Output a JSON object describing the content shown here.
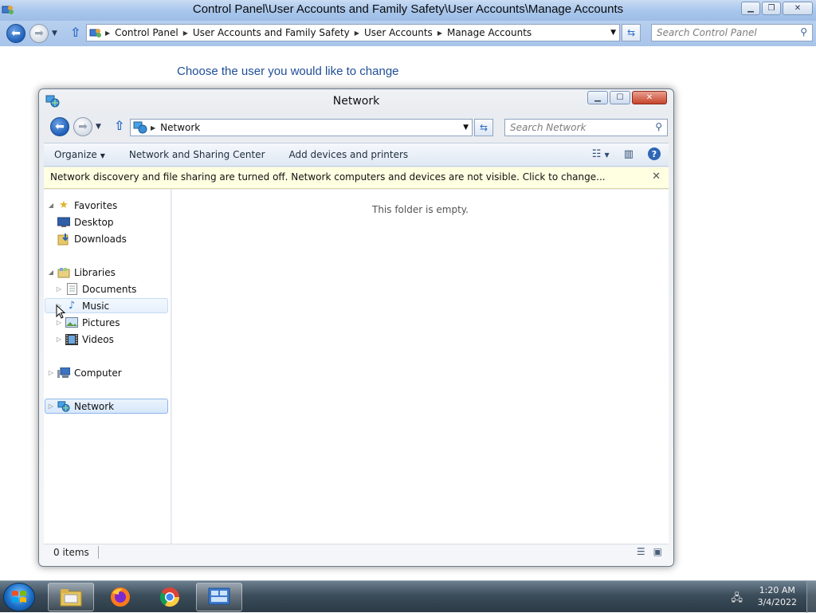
{
  "background_window": {
    "title": "Control Panel\\User Accounts and Family Safety\\User Accounts\\Manage Accounts",
    "breadcrumbs": [
      "Control Panel",
      "User Accounts and Family Safety",
      "User Accounts",
      "Manage Accounts"
    ],
    "search_placeholder": "Search Control Panel",
    "heading": "Choose the user you would like to change"
  },
  "network_window": {
    "title": "Network",
    "address": "Network",
    "search_placeholder": "Search Network",
    "toolbar": {
      "organize": "Organize",
      "network_center": "Network and Sharing Center",
      "add_devices": "Add devices and printers"
    },
    "infobar": "Network discovery and file sharing are turned off. Network computers and devices are not visible. Click to change...",
    "nav_tree": {
      "favorites": "Favorites",
      "desktop": "Desktop",
      "downloads": "Downloads",
      "libraries": "Libraries",
      "documents": "Documents",
      "music": "Music",
      "pictures": "Pictures",
      "videos": "Videos",
      "computer": "Computer",
      "network": "Network"
    },
    "empty_message": "This folder is empty.",
    "status": "0 items"
  },
  "taskbar": {
    "apps": [
      "windows-explorer",
      "firefox",
      "chrome",
      "control-panel"
    ],
    "time": "1:20 AM",
    "date": "3/4/2022"
  },
  "colors": {
    "accent_blue": "#1f4e96",
    "infobar_bg": "#ffffe1",
    "selection": "#d6e7fb"
  }
}
